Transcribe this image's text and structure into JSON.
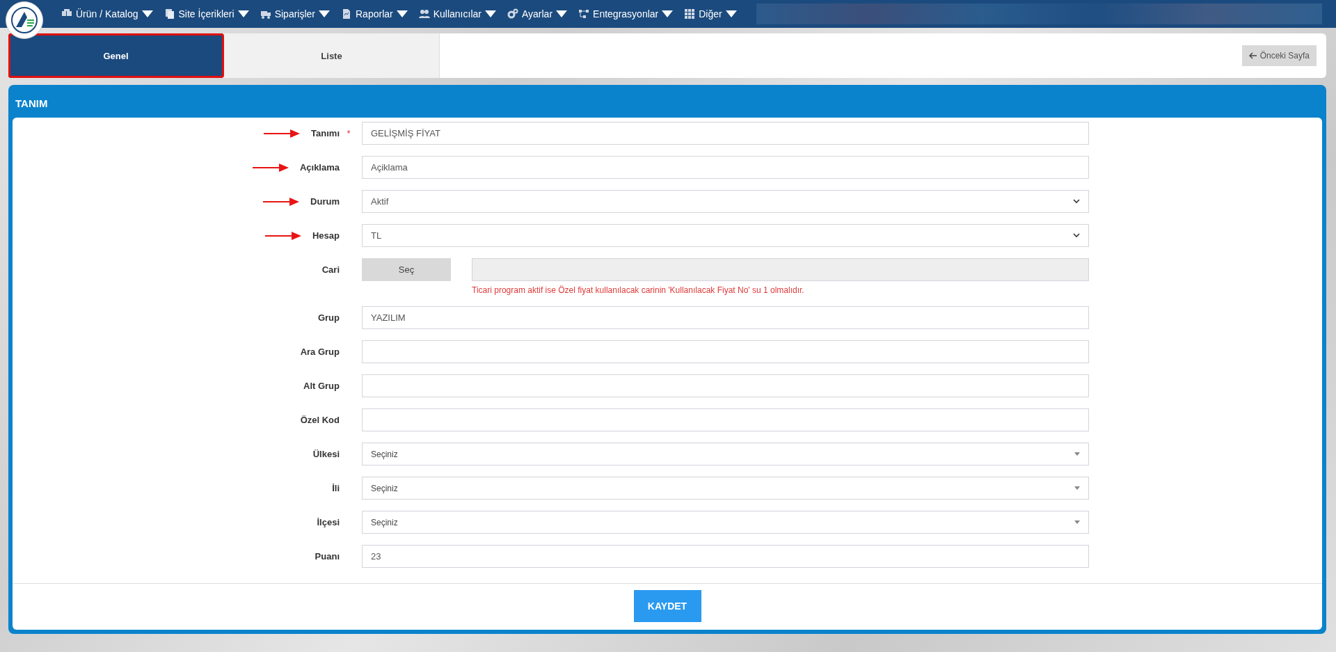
{
  "nav": {
    "items": [
      {
        "label": "Ürün / Katalog",
        "kind": "boxes"
      },
      {
        "label": "Site İçerikleri",
        "kind": "pages"
      },
      {
        "label": "Siparişler",
        "kind": "truck"
      },
      {
        "label": "Raporlar",
        "kind": "report"
      },
      {
        "label": "Kullanıcılar",
        "kind": "users"
      },
      {
        "label": "Ayarlar",
        "kind": "gears"
      },
      {
        "label": "Entegrasyonlar",
        "kind": "nodes"
      },
      {
        "label": "Diğer",
        "kind": "grid"
      }
    ]
  },
  "tabs": [
    {
      "label": "Genel",
      "selected": true,
      "highlighted": true
    },
    {
      "label": "Liste",
      "selected": false,
      "highlighted": false
    }
  ],
  "back_button": "Önceki Sayfa",
  "panel": {
    "title": "TANIM",
    "fields": [
      {
        "label": "Tanımı",
        "kind": "text",
        "required_mark": "*",
        "arrow": true,
        "value": "GELİŞMİŞ FİYAT"
      },
      {
        "label": "Açıklama",
        "kind": "text",
        "arrow": true,
        "value": "Açiklama"
      },
      {
        "label": "Durum",
        "kind": "select",
        "arrow": true,
        "value": "Aktif"
      },
      {
        "label": "Hesap",
        "kind": "select",
        "arrow": true,
        "value": "TL"
      },
      {
        "label": "Cari",
        "kind": "picker",
        "arrow": false,
        "button": "Seç",
        "note": "Ticari program aktif ise Özel fiyat kullanılacak carinin 'Kullanılacak Fiyat No' su 1 olmalıdır."
      },
      {
        "label": "Grup",
        "kind": "text",
        "arrow": false,
        "value": "YAZILIM"
      },
      {
        "label": "Ara Grup",
        "kind": "text",
        "arrow": false
      },
      {
        "label": "Alt Grup",
        "kind": "text",
        "arrow": false
      },
      {
        "label": "Özel Kod",
        "kind": "text",
        "arrow": false
      },
      {
        "label": "Ülkesi",
        "kind": "combo",
        "arrow": false,
        "value": "Seçiniz"
      },
      {
        "label": "İli",
        "kind": "combo",
        "arrow": false,
        "value": "Seçiniz"
      },
      {
        "label": "İlçesi",
        "kind": "combo",
        "arrow": false,
        "value": "Seçiniz"
      },
      {
        "label": "Puanı",
        "kind": "text",
        "arrow": false,
        "value": "23"
      }
    ],
    "save_button": "KAYDET"
  }
}
